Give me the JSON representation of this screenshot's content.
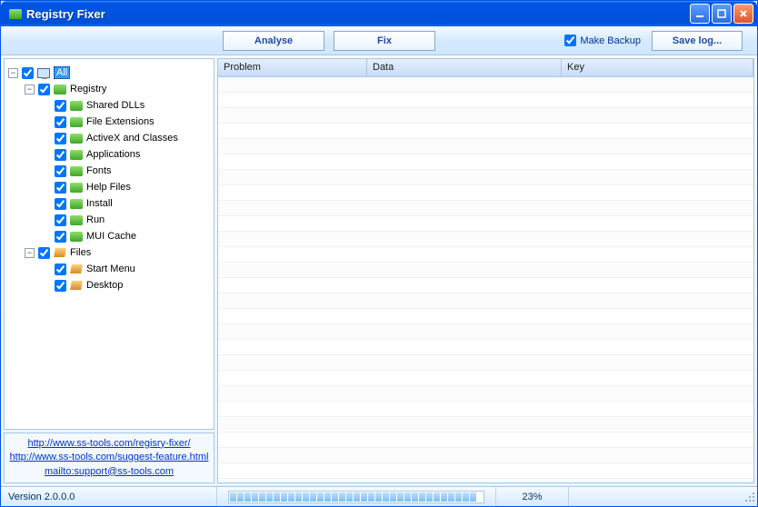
{
  "window": {
    "title": "Registry Fixer"
  },
  "toolbar": {
    "analyse": "Analyse",
    "fix": "Fix",
    "make_backup": "Make Backup",
    "save_log": "Save log..."
  },
  "tree": {
    "all": "All",
    "registry": "Registry",
    "registry_children": [
      "Shared DLLs",
      "File Extensions",
      "ActiveX and Classes",
      "Applications",
      "Fonts",
      "Help Files",
      "Install",
      "Run",
      "MUI Cache"
    ],
    "files": "Files",
    "files_children": [
      "Start Menu",
      "Desktop"
    ]
  },
  "links": {
    "a": "http://www.ss-tools.com/regisry-fixer/",
    "b": "http://www.ss-tools.com/suggest-feature.html",
    "c": "mailto:support@ss-tools.com"
  },
  "grid": {
    "cols": {
      "problem": "Problem",
      "data": "Data",
      "key": "Key"
    }
  },
  "status": {
    "version": "Version 2.0.0.0",
    "percent": "23%"
  }
}
